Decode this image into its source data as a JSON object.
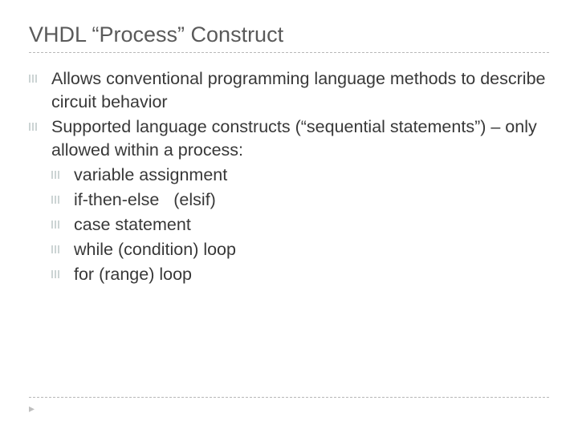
{
  "title": "VHDL “Process” Construct",
  "bullets": [
    {
      "text": "Allows conventional programming language methods to describe circuit behavior"
    },
    {
      "text": "Supported language constructs (“sequential statements”) – only allowed within a process:",
      "sub": [
        "variable assignment",
        "if-then-else   (elsif)",
        "case statement",
        "while (condition) loop",
        "for (range) loop"
      ]
    }
  ],
  "footer_mark": "▸"
}
